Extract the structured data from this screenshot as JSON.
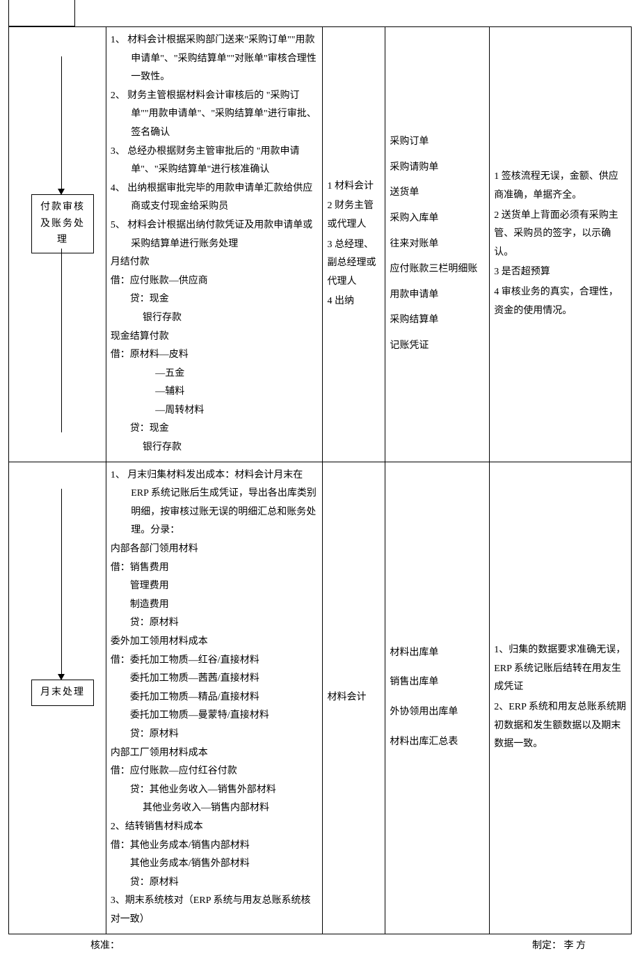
{
  "row1": {
    "step_label": "付款审核及账务处理",
    "desc": [
      {
        "cls": "num-item",
        "t": "1、 材料会计根据采购部门送来\"采购订单\"\"用款申请单\"、\"采购结算单\"\"对账单\"审核合理性一致性。"
      },
      {
        "cls": "num-item",
        "t": "2、 财务主管根据材料会计审核后的 \"采购订单\"\"用款申请单\"、\"采购结算单\"进行审批、签名确认"
      },
      {
        "cls": "num-item",
        "t": "3、 总经办根据财务主管审批后的 \"用款申请单\"、\"采购结算单\"进行核准确认"
      },
      {
        "cls": "num-item",
        "t": "4、 出纳根据审批完毕的用款申请单汇款给供应商或支付现金给采购员"
      },
      {
        "cls": "num-item",
        "t": "5、 材料会计根据出纳付款凭证及用款申请单或采购结算单进行账务处理"
      },
      {
        "cls": "plain",
        "t": "月结付款"
      },
      {
        "cls": "plain",
        "t": "借：应付账款—供应商"
      },
      {
        "cls": "ind1",
        "t": "贷：现金"
      },
      {
        "cls": "ind2",
        "t": "银行存款"
      },
      {
        "cls": "plain",
        "t": "现金结算付款"
      },
      {
        "cls": "plain",
        "t": "借：原材料—皮料"
      },
      {
        "cls": "ind3",
        "t": "—五金"
      },
      {
        "cls": "ind3",
        "t": "—辅料"
      },
      {
        "cls": "ind3",
        "t": "—周转材料"
      },
      {
        "cls": "ind1",
        "t": "贷：现金"
      },
      {
        "cls": "ind2",
        "t": "银行存款"
      }
    ],
    "roles": [
      "1 材料会计",
      "2 财务主管或代理人",
      "3 总经理、副总经理或代理人",
      "4 出纳"
    ],
    "docs": [
      "采购订单",
      "采购请购单",
      "送货单",
      "采购入库单",
      "往来对账单",
      "应付账款三栏明细账",
      "用款申请单",
      "采购结算单",
      "记账凭证"
    ],
    "notes": [
      "1 签核流程无误，金额、供应商准确，单据齐全。",
      "2 送货单上背面必须有采购主管、采购员的签字，以示确认。",
      "3 是否超预算",
      "4 审核业务的真实，合理性，资金的使用情况。"
    ]
  },
  "row2": {
    "step_label": "月末处理",
    "desc": [
      {
        "cls": "num-item",
        "t": "1、 月末归集材料发出成本：材料会计月末在 ERP 系统记账后生成凭证，导出各出库类别明细，按审核过账无误的明细汇总和账务处理。分录："
      },
      {
        "cls": "plain",
        "t": "内部各部门领用材料"
      },
      {
        "cls": "plain",
        "t": "借：销售费用"
      },
      {
        "cls": "ind1",
        "t": "管理费用"
      },
      {
        "cls": "ind1",
        "t": "制造费用"
      },
      {
        "cls": "ind1",
        "t": "贷：原材料"
      },
      {
        "cls": "plain",
        "t": "委外加工领用材料成本"
      },
      {
        "cls": "plain",
        "t": " 借：委托加工物质—红谷/直接材料"
      },
      {
        "cls": "ind1",
        "t": " 委托加工物质—茜茜/直接材料"
      },
      {
        "cls": "ind1",
        "t": " 委托加工物质—精品/直接材料"
      },
      {
        "cls": "ind1",
        "t": " 委托加工物质—曼蒙特/直接材料"
      },
      {
        "cls": "ind1",
        "t": "贷：原材料"
      },
      {
        "cls": "plain",
        "t": "内部工厂领用材料成本"
      },
      {
        "cls": "plain",
        "t": "借：应付账款—应付红谷付款"
      },
      {
        "cls": "ind1",
        "t": "贷：其他业务收入—销售外部材料"
      },
      {
        "cls": "ind2",
        "t": "其他业务收入—销售内部材料"
      },
      {
        "cls": "plain",
        "t": "2、结转销售材料成本"
      },
      {
        "cls": "plain",
        "t": "借：其他业务成本/销售内部材料"
      },
      {
        "cls": "ind1",
        "t": "其他业务成本/销售外部材料"
      },
      {
        "cls": "ind1",
        "t": "贷：原材料"
      },
      {
        "cls": "plain",
        "t": "3、期末系统核对（ERP 系统与用友总账系统核对一致）"
      }
    ],
    "roles": [
      "材料会计"
    ],
    "docs": [
      "材料出库单",
      "销售出库单",
      "外协领用出库单",
      "材料出库汇总表"
    ],
    "notes": [
      "1、归集的数据要求准确无误，ERP 系统记账后结转在用友生成凭证",
      "2、ERP 系统和用友总账系统期初数据和发生额数据以及期末数据一致。"
    ]
  },
  "footer": {
    "left": "核准：",
    "right": "制定：  李  方"
  }
}
